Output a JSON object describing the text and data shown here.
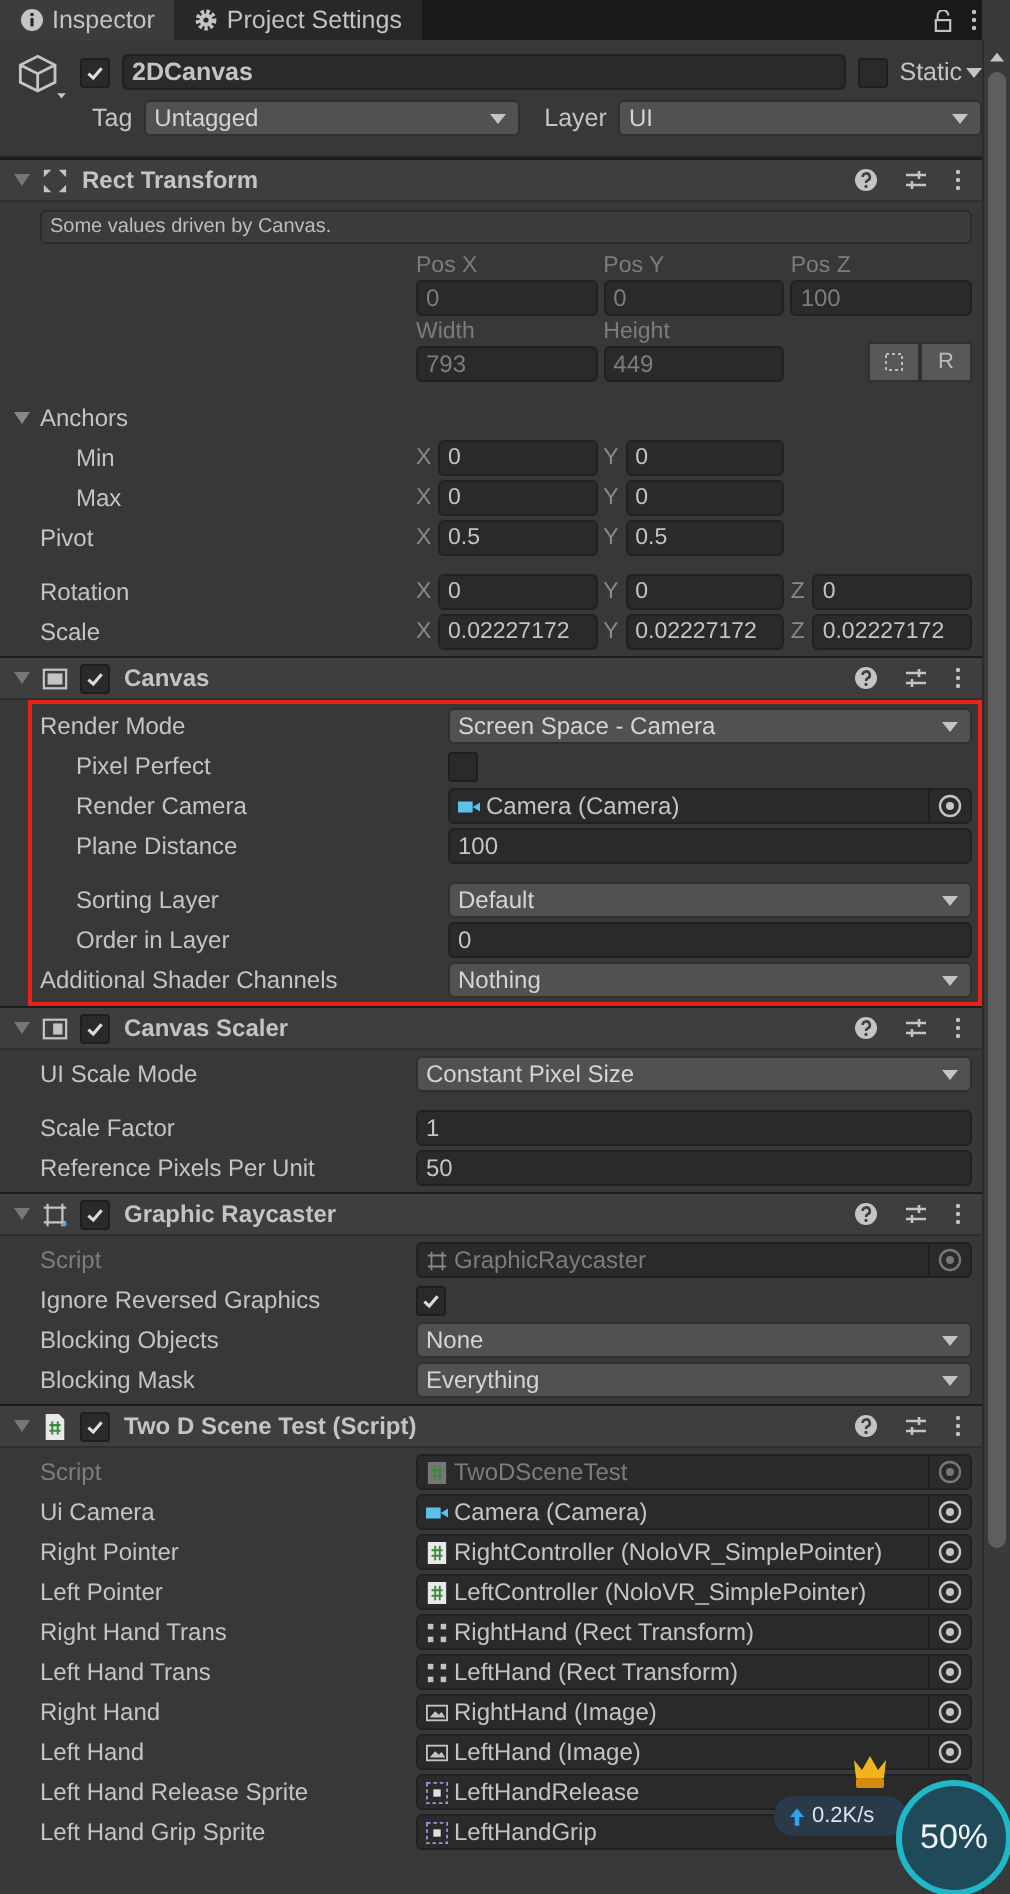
{
  "tabs": [
    {
      "label": "Inspector",
      "kind": "info",
      "selected": true
    },
    {
      "label": "Project Settings",
      "kind": "gear",
      "selected": false
    }
  ],
  "object": {
    "active": true,
    "name": "2DCanvas",
    "static_label": "Static",
    "static": false,
    "tag_label": "Tag",
    "tag": "Untagged",
    "layer_label": "Layer",
    "layer": "UI"
  },
  "components": [
    {
      "title": "Rect Transform",
      "kind": "rect_transform",
      "expanded": true,
      "highlighted": false,
      "note": "Some values driven by Canvas.",
      "rows": [
        {
          "kind": "captioned",
          "disabled": true,
          "fields": [
            {
              "caption": "Pos X",
              "value": "0"
            },
            {
              "caption": "Pos Y",
              "value": "0"
            },
            {
              "caption": "Pos Z",
              "value": "100"
            }
          ]
        },
        {
          "kind": "captioned",
          "disabled": true,
          "fields": [
            {
              "caption": "Width",
              "value": "793"
            },
            {
              "caption": "Height",
              "value": "449"
            }
          ],
          "buttons": [
            {
              "kind": "blueprint"
            },
            {
              "kind": "raw",
              "label": "R"
            }
          ]
        },
        {
          "kind": "foldout",
          "label": "Anchors",
          "expanded": true,
          "gap": true,
          "children": [
            {
              "kind": "vector",
              "label": "Min",
              "fields": [
                {
                  "axis": "X",
                  "value": "0"
                },
                {
                  "axis": "Y",
                  "value": "0"
                }
              ]
            },
            {
              "kind": "vector",
              "label": "Max",
              "fields": [
                {
                  "axis": "X",
                  "value": "0"
                },
                {
                  "axis": "Y",
                  "value": "0"
                }
              ]
            }
          ]
        },
        {
          "kind": "vector",
          "label": "Pivot",
          "fields": [
            {
              "axis": "X",
              "value": "0.5"
            },
            {
              "axis": "Y",
              "value": "0.5"
            }
          ]
        },
        {
          "kind": "vector",
          "label": "Rotation",
          "gap": true,
          "fields": [
            {
              "axis": "X",
              "value": "0"
            },
            {
              "axis": "Y",
              "value": "0"
            },
            {
              "axis": "Z",
              "value": "0"
            }
          ]
        },
        {
          "kind": "vector",
          "label": "Scale",
          "fields": [
            {
              "axis": "X",
              "value": "0.02227172"
            },
            {
              "axis": "Y",
              "value": "0.02227172"
            },
            {
              "axis": "Z",
              "value": "0.02227172"
            }
          ]
        }
      ]
    },
    {
      "title": "Canvas",
      "kind": "canvas",
      "enabled": true,
      "expanded": true,
      "highlighted": true,
      "rows": [
        {
          "kind": "dropdown",
          "label": "Render Mode",
          "value": "Screen Space - Camera",
          "children": [
            {
              "kind": "checkbox",
              "label": "Pixel Perfect",
              "checked": false
            },
            {
              "kind": "camera_object",
              "label": "Render Camera",
              "value": "Camera (Camera)"
            },
            {
              "kind": "number",
              "label": "Plane Distance",
              "value": "100"
            },
            {
              "kind": "dropdown",
              "label": "Sorting Layer",
              "value": "Default",
              "gap": true
            },
            {
              "kind": "number",
              "label": "Order in Layer",
              "value": "0"
            }
          ]
        },
        {
          "kind": "dropdown",
          "label": "Additional Shader Channels",
          "value": "Nothing"
        }
      ]
    },
    {
      "title": "Canvas Scaler",
      "kind": "canvas_scaler",
      "enabled": true,
      "expanded": true,
      "highlighted": false,
      "rows": [
        {
          "kind": "dropdown",
          "label": "UI Scale Mode",
          "value": "Constant Pixel Size"
        },
        {
          "kind": "number",
          "label": "Scale Factor",
          "value": "1",
          "gap": true
        },
        {
          "kind": "number",
          "label": "Reference Pixels Per Unit",
          "value": "50"
        }
      ]
    },
    {
      "title": "Graphic Raycaster",
      "kind": "raycaster",
      "enabled": true,
      "expanded": true,
      "highlighted": false,
      "rows": [
        {
          "kind": "raycaster_object",
          "label": "Script",
          "value": "GraphicRaycaster",
          "disabled": true
        },
        {
          "kind": "checkbox",
          "label": "Ignore Reversed Graphics",
          "checked": true
        },
        {
          "kind": "dropdown",
          "label": "Blocking Objects",
          "value": "None"
        },
        {
          "kind": "dropdown",
          "label": "Blocking Mask",
          "value": "Everything"
        }
      ]
    },
    {
      "title": "Two D Scene Test (Script)",
      "kind": "script",
      "enabled": true,
      "expanded": true,
      "highlighted": false,
      "rows": [
        {
          "kind": "script_object",
          "label": "Script",
          "value": "TwoDSceneTest",
          "disabled": true
        },
        {
          "kind": "camera_object",
          "label": "Ui Camera",
          "value": "Camera (Camera)"
        },
        {
          "kind": "script_object",
          "label": "Right Pointer",
          "value": "RightController (NoloVR_SimplePointer)"
        },
        {
          "kind": "script_object",
          "label": "Left Pointer",
          "value": "LeftController (NoloVR_SimplePointer)"
        },
        {
          "kind": "rect_object",
          "label": "Right Hand Trans",
          "value": "RightHand (Rect Transform)"
        },
        {
          "kind": "rect_object",
          "label": "Left Hand Trans",
          "value": "LeftHand (Rect Transform)"
        },
        {
          "kind": "image_object",
          "label": "Right Hand",
          "value": "RightHand (Image)"
        },
        {
          "kind": "image_object",
          "label": "Left Hand",
          "value": "LeftHand (Image)"
        },
        {
          "kind": "sprite_object",
          "label": "Left Hand Release Sprite",
          "value": "LeftHandRelease",
          "picker": false
        },
        {
          "kind": "sprite_object",
          "label": "Left Hand Grip Sprite",
          "value": "LeftHandGrip",
          "picker": false
        }
      ]
    }
  ],
  "speed_widget": {
    "upload": "0.2K/s",
    "percent": "50%"
  }
}
